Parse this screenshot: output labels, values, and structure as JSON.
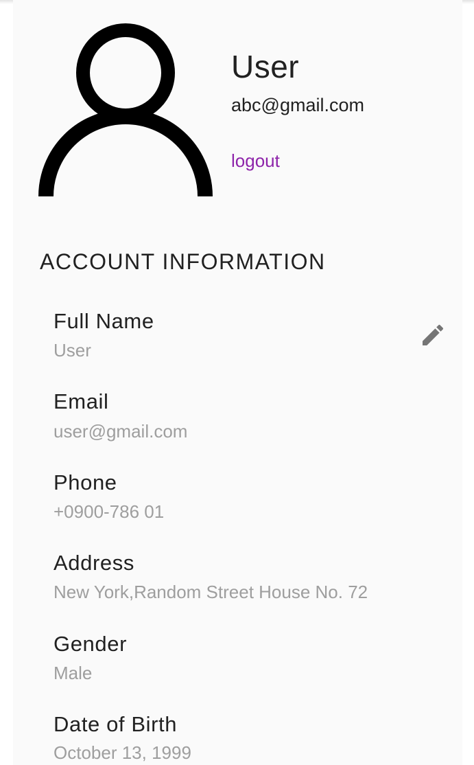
{
  "profile": {
    "name": "User",
    "email": "abc@gmail.com",
    "logout_label": "logout",
    "avatar_icon": "person-outline-icon"
  },
  "account": {
    "section_title": "ACCOUNT INFORMATION",
    "edit_icon": "pencil-icon",
    "fields": [
      {
        "label": "Full Name",
        "value": "User"
      },
      {
        "label": "Email",
        "value": "user@gmail.com"
      },
      {
        "label": "Phone",
        "value": "+0900-786 01"
      },
      {
        "label": "Address",
        "value": "New York,Random Street House No. 72"
      },
      {
        "label": "Gender",
        "value": "Male"
      },
      {
        "label": "Date of Birth",
        "value": "October 13, 1999"
      }
    ]
  },
  "colors": {
    "accent": "#8e24aa",
    "label": "#212121",
    "value": "#9e9e9e",
    "card_background": "#fafafa",
    "icon": "#757575"
  }
}
